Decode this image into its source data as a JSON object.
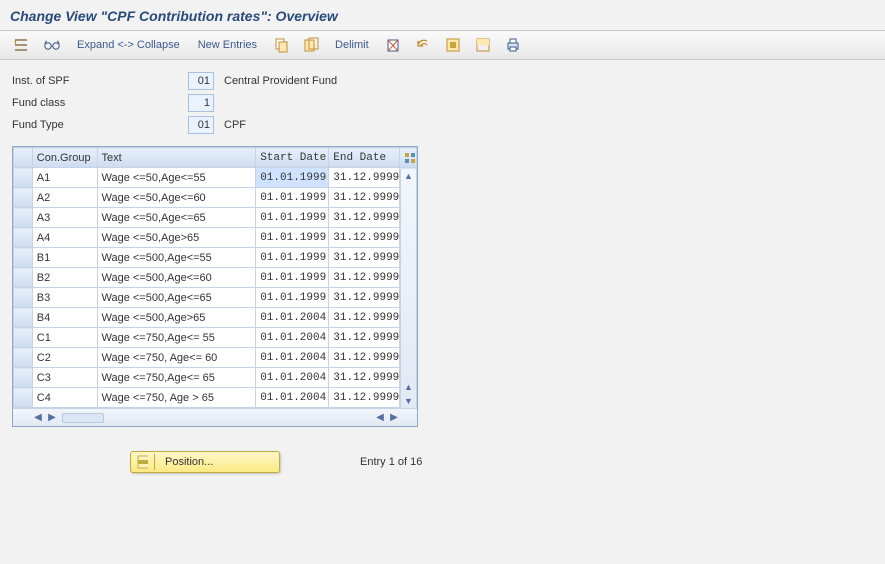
{
  "title": "Change View \"CPF Contribution rates\": Overview",
  "toolbar": {
    "expand_collapse": "Expand <-> Collapse",
    "new_entries": "New Entries",
    "delimit": "Delimit"
  },
  "header": {
    "inst_label": "Inst. of SPF",
    "inst_code": "01",
    "inst_desc": "Central Provident Fund",
    "class_label": "Fund class",
    "class_code": "1",
    "type_label": "Fund Type",
    "type_code": "01",
    "type_desc": "CPF"
  },
  "table": {
    "headers": {
      "group": "Con.Group",
      "text": "Text",
      "start": "Start Date",
      "end": "End Date"
    },
    "rows": [
      {
        "grp": "A1",
        "text": "Wage <=50,Age<=55",
        "start": "01.01.1999",
        "end": "31.12.9999",
        "sel": true
      },
      {
        "grp": "A2",
        "text": "Wage <=50,Age<=60",
        "start": "01.01.1999",
        "end": "31.12.9999"
      },
      {
        "grp": "A3",
        "text": "Wage <=50,Age<=65",
        "start": "01.01.1999",
        "end": "31.12.9999"
      },
      {
        "grp": "A4",
        "text": "Wage <=50,Age>65",
        "start": "01.01.1999",
        "end": "31.12.9999"
      },
      {
        "grp": "B1",
        "text": "Wage <=500,Age<=55",
        "start": "01.01.1999",
        "end": "31.12.9999"
      },
      {
        "grp": "B2",
        "text": "Wage <=500,Age<=60",
        "start": "01.01.1999",
        "end": "31.12.9999"
      },
      {
        "grp": "B3",
        "text": "Wage <=500,Age<=65",
        "start": "01.01.1999",
        "end": "31.12.9999"
      },
      {
        "grp": "B4",
        "text": "Wage <=500,Age>65",
        "start": "01.01.2004",
        "end": "31.12.9999"
      },
      {
        "grp": "C1",
        "text": "Wage <=750,Age<= 55",
        "start": "01.01.2004",
        "end": "31.12.9999"
      },
      {
        "grp": "C2",
        "text": "Wage <=750, Age<= 60",
        "start": "01.01.2004",
        "end": "31.12.9999"
      },
      {
        "grp": "C3",
        "text": "Wage <=750,Age<= 65",
        "start": "01.01.2004",
        "end": "31.12.9999"
      },
      {
        "grp": "C4",
        "text": "Wage <=750, Age > 65",
        "start": "01.01.2004",
        "end": "31.12.9999"
      }
    ]
  },
  "footer": {
    "position_label": "Position...",
    "entry_text": "Entry 1 of 16"
  }
}
